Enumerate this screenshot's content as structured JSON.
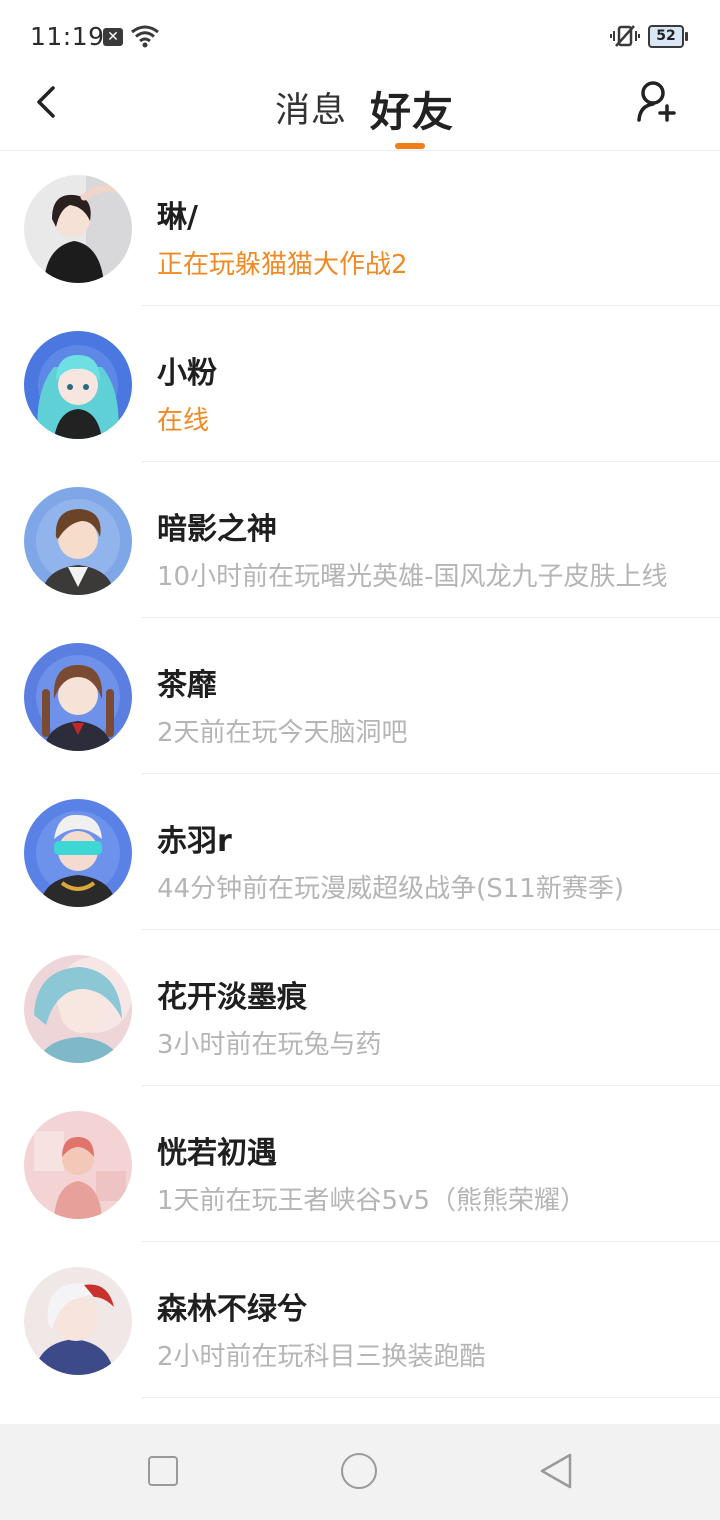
{
  "status_bar": {
    "time": "11:19",
    "notification_icon": "x-box-icon",
    "battery": "52"
  },
  "header": {
    "tabs": [
      {
        "label": "消息",
        "active": false
      },
      {
        "label": "好友",
        "active": true
      }
    ],
    "accent_color": "#f07f1a"
  },
  "friends": [
    {
      "name": "琳/",
      "status": "正在玩躲猫猫大作战2",
      "active": true
    },
    {
      "name": "小粉",
      "status": "在线",
      "active": true
    },
    {
      "name": "暗影之神",
      "status": "10小时前在玩曙光英雄-国风龙九子皮肤上线",
      "active": false
    },
    {
      "name": "茶靡",
      "status": "2天前在玩今天脑洞吧",
      "active": false
    },
    {
      "name": "赤羽r",
      "status": "44分钟前在玩漫威超级战争(S11新赛季)",
      "active": false
    },
    {
      "name": "花开淡墨痕",
      "status": "3小时前在玩兔与药",
      "active": false
    },
    {
      "name": "恍若初遇",
      "status": "1天前在玩王者峡谷5v5（熊熊荣耀）",
      "active": false
    },
    {
      "name": "森林不绿兮",
      "status": "2小时前在玩科目三换装跑酷",
      "active": false
    }
  ],
  "colors": {
    "active_status": "#f08a24",
    "inactive_status": "#b5b5b5"
  }
}
